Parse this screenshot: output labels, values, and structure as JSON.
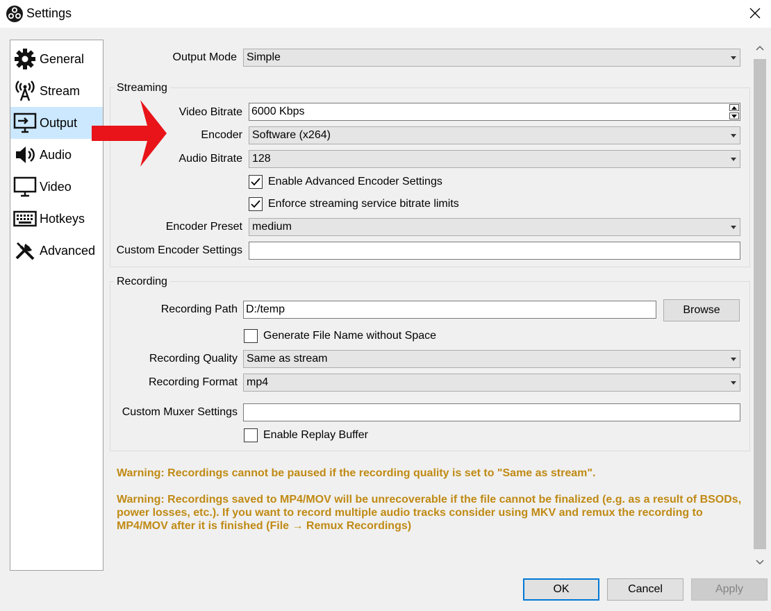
{
  "window": {
    "title": "Settings"
  },
  "sidebar": {
    "items": [
      {
        "label": "General",
        "icon": "gear-icon"
      },
      {
        "label": "Stream",
        "icon": "antenna-icon"
      },
      {
        "label": "Output",
        "icon": "monitor-output-icon",
        "selected": true
      },
      {
        "label": "Audio",
        "icon": "speaker-icon"
      },
      {
        "label": "Video",
        "icon": "monitor-icon"
      },
      {
        "label": "Hotkeys",
        "icon": "keyboard-icon"
      },
      {
        "label": "Advanced",
        "icon": "tools-icon"
      }
    ]
  },
  "output_mode": {
    "label": "Output Mode",
    "value": "Simple"
  },
  "streaming": {
    "title": "Streaming",
    "video_bitrate": {
      "label": "Video Bitrate",
      "value": "6000 Kbps"
    },
    "encoder": {
      "label": "Encoder",
      "value": "Software (x264)"
    },
    "audio_bitrate": {
      "label": "Audio Bitrate",
      "value": "128"
    },
    "advanced_encoder": {
      "label": "Enable Advanced Encoder Settings",
      "checked": true
    },
    "enforce_limits": {
      "label": "Enforce streaming service bitrate limits",
      "checked": true
    },
    "encoder_preset": {
      "label": "Encoder Preset",
      "value": "medium"
    },
    "custom_encoder": {
      "label": "Custom Encoder Settings",
      "value": ""
    }
  },
  "recording": {
    "title": "Recording",
    "path": {
      "label": "Recording Path",
      "value": "D:/temp"
    },
    "browse_label": "Browse",
    "no_space": {
      "label": "Generate File Name without Space",
      "checked": false
    },
    "quality": {
      "label": "Recording Quality",
      "value": "Same as stream"
    },
    "format": {
      "label": "Recording Format",
      "value": "mp4"
    },
    "muxer": {
      "label": "Custom Muxer Settings",
      "value": ""
    },
    "replay_buffer": {
      "label": "Enable Replay Buffer",
      "checked": false
    }
  },
  "warnings": {
    "pause": "Warning: Recordings cannot be paused if the recording quality is set to \"Same as stream\".",
    "mp4": "Warning: Recordings saved to MP4/MOV will be unrecoverable if the file cannot be finalized (e.g. as a result of BSODs, power losses, etc.). If you want to record multiple audio tracks consider using MKV and remux the recording to MP4/MOV after it is finished (File → Remux Recordings)"
  },
  "footer": {
    "ok_label": "OK",
    "cancel_label": "Cancel",
    "apply_label": "Apply"
  },
  "colors": {
    "warning": "#c08a14",
    "selected_bg": "#cce8ff",
    "annotation_arrow": "#e8141a"
  }
}
